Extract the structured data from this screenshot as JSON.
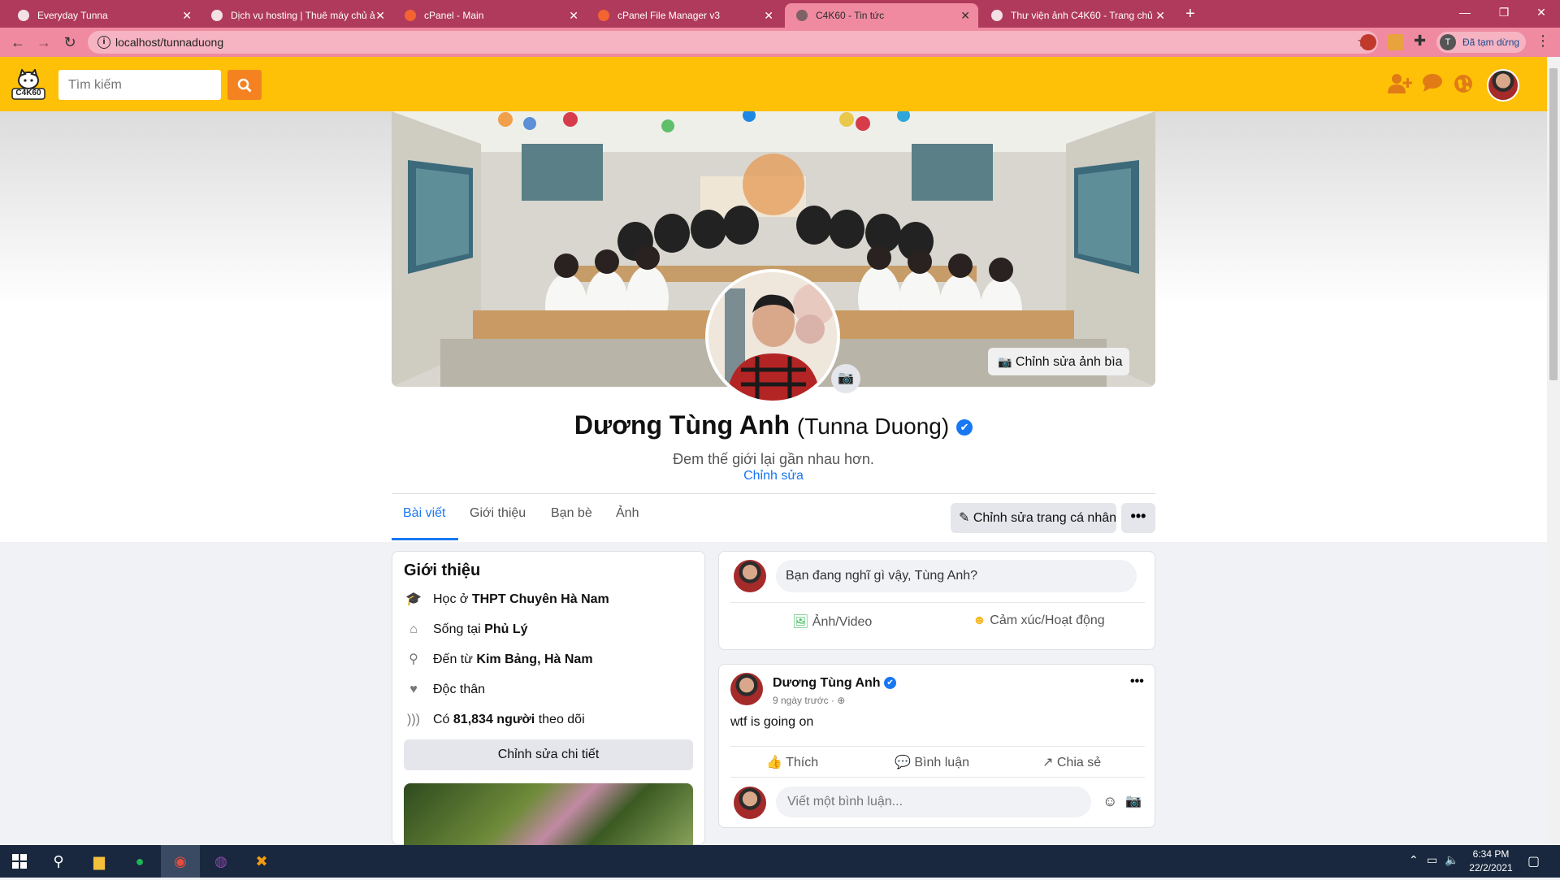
{
  "browser": {
    "tabs": [
      {
        "label": "Everyday Tunna",
        "active": false
      },
      {
        "label": "Dịch vụ hosting | Thuê máy chủ ả",
        "active": false
      },
      {
        "label": "cPanel - Main",
        "active": false
      },
      {
        "label": "cPanel File Manager v3",
        "active": false
      },
      {
        "label": "C4K60 - Tin tức",
        "active": true
      },
      {
        "label": "Thư viện ảnh C4K60 - Trang chủ",
        "active": false
      }
    ],
    "url": "localhost/tunnaduong",
    "profile_initial": "T",
    "paused_label": "Đã tạm dừng",
    "accent": "#b03a5b"
  },
  "site": {
    "logo_text": "C4K60",
    "search_placeholder": "Tìm kiếm",
    "header_color": "#fec107",
    "header_icons": [
      "add-friend-icon",
      "chat-icon",
      "globe-icon"
    ]
  },
  "profile": {
    "edit_cover": "Chỉnh sửa ảnh bìa",
    "name": "Dương Tùng Anh",
    "alt_name": "(Tunna Duong)",
    "bio": "Đem thế giới lại gần nhau hơn.",
    "edit_bio": "Chỉnh sửa",
    "tabs": [
      "Bài viết",
      "Giới thiệu",
      "Bạn bè",
      "Ảnh"
    ],
    "active_tab": "Bài viết",
    "edit_profile": "Chỉnh sửa trang cá nhân",
    "more": "•••"
  },
  "intro": {
    "title": "Giới thiệu",
    "rows": [
      {
        "icon": "graduation-cap-icon",
        "prefix": "Học ở ",
        "value": "THPT Chuyên Hà Nam",
        "suffix": ""
      },
      {
        "icon": "home-icon",
        "prefix": "Sống tại ",
        "value": "Phủ Lý",
        "suffix": ""
      },
      {
        "icon": "map-pin-icon",
        "prefix": "Đến từ ",
        "value": "Kim Bảng, Hà Nam",
        "suffix": ""
      },
      {
        "icon": "heart-icon",
        "prefix": "Độc thân",
        "value": "",
        "suffix": ""
      },
      {
        "icon": "rss-icon",
        "prefix": "Có ",
        "value": "81,834 người",
        "suffix": " theo dõi"
      }
    ],
    "edit_details": "Chỉnh sửa chi tiết"
  },
  "composer": {
    "placeholder": "Bạn đang nghĩ gì vậy, Tùng Anh?",
    "photo_video": "Ảnh/Video",
    "feeling": "Cảm xúc/Hoạt động"
  },
  "post": {
    "author": "Dương Tùng Anh",
    "time": "9 ngày trước ·",
    "text": "wtf is going on",
    "like": "Thích",
    "comment": "Bình luận",
    "share": "Chia sẻ",
    "comment_placeholder": "Viết một bình luận..."
  },
  "taskbar": {
    "time": "6:34 PM",
    "date": "22/2/2021"
  }
}
